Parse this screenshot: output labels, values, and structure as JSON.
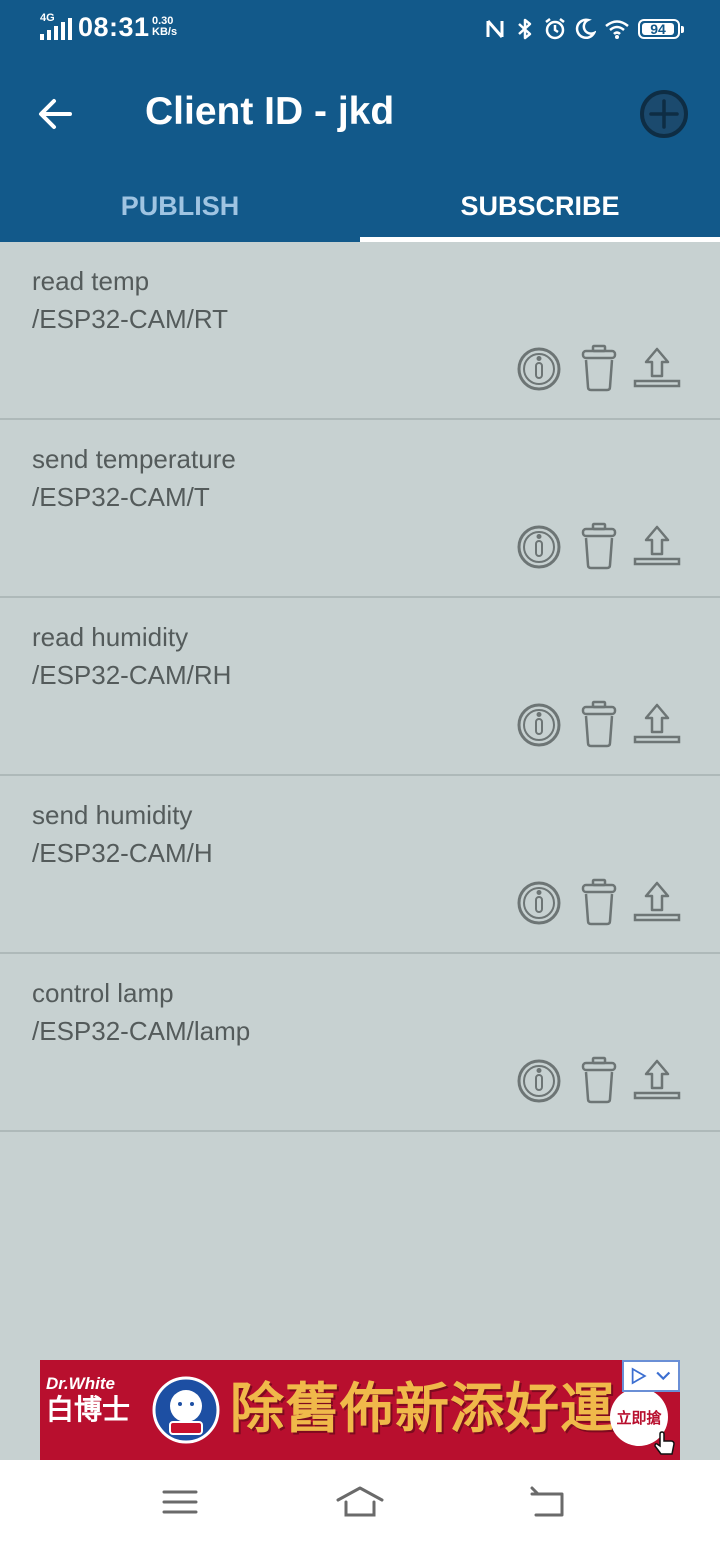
{
  "status_bar": {
    "network": "4G",
    "time": "08:31",
    "speed_value": "0.30",
    "speed_unit": "KB/s",
    "battery": "94",
    "icons": [
      "nfc-icon",
      "bluetooth-icon",
      "alarm-icon",
      "moon-icon",
      "wifi-icon",
      "battery-icon"
    ]
  },
  "app_bar": {
    "title": "Client ID - jkd",
    "back_icon": "arrow-left-icon",
    "add_icon": "plus-circle-icon"
  },
  "tabs": [
    {
      "label": "PUBLISH",
      "active": false
    },
    {
      "label": "SUBSCRIBE",
      "active": true
    }
  ],
  "subscriptions": [
    {
      "name": "read temp",
      "topic": "/ESP32-CAM/RT"
    },
    {
      "name": "send temperature",
      "topic": "/ESP32-CAM/T"
    },
    {
      "name": "read humidity",
      "topic": "/ESP32-CAM/RH"
    },
    {
      "name": "send humidity",
      "topic": "/ESP32-CAM/H"
    },
    {
      "name": "control lamp",
      "topic": "/ESP32-CAM/lamp"
    }
  ],
  "row_actions": [
    "info-icon",
    "trash-icon",
    "upload-icon"
  ],
  "ad": {
    "brand_top": "Dr.White",
    "brand_bottom": "白博士",
    "slogan": "除舊佈新添好運",
    "cta": "立即搶"
  },
  "nav_bar": {
    "icons": [
      "menu-icon",
      "home-icon",
      "back-icon"
    ]
  },
  "colors": {
    "app_bar": "#12598a",
    "background": "#c7d1d1",
    "text": "#545b5b",
    "ad_background": "#b80f2e"
  }
}
